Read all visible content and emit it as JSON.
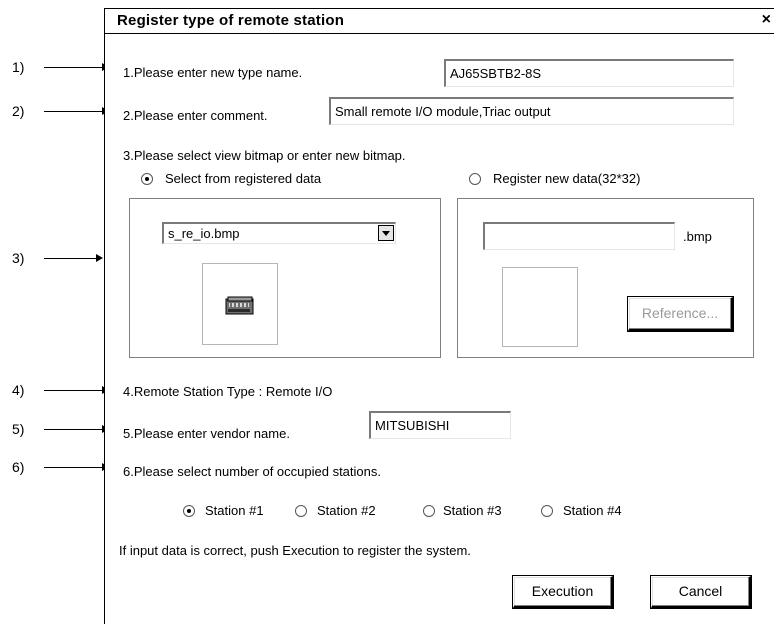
{
  "dialog": {
    "title": "Register type of remote station",
    "close_glyph": "×"
  },
  "callouts": [
    "1)",
    "2)",
    "3)",
    "4)",
    "5)",
    "6)"
  ],
  "step1": {
    "label": "1.Please enter new type name.",
    "value": "AJ65SBTB2-8S"
  },
  "step2": {
    "label": "2.Please enter comment.",
    "value": "Small remote I/O module,Triac output"
  },
  "step3": {
    "label": "3.Please select view bitmap or enter new bitmap.",
    "option_registered": "Select from registered data",
    "option_new": "Register new data(32*32)",
    "selected_bitmap": "s_re_io.bmp",
    "new_filename": "",
    "extension": ".bmp",
    "reference_button": "Reference..."
  },
  "step4": {
    "label": "4.Remote Station Type : Remote I/O"
  },
  "step5": {
    "label": "5.Please enter vendor name.",
    "value": "MITSUBISHI"
  },
  "step6": {
    "label": "6.Please select number of occupied stations.",
    "stations": [
      "Station #1",
      "Station #2",
      "Station #3",
      "Station #4"
    ],
    "selected": "Station #1"
  },
  "footer": {
    "note": "If  input data is correct, push Execution to register the system.",
    "execute_button": "Execution",
    "cancel_button": "Cancel"
  },
  "icons": {
    "module_bitmap": "remote-io-module-icon"
  }
}
